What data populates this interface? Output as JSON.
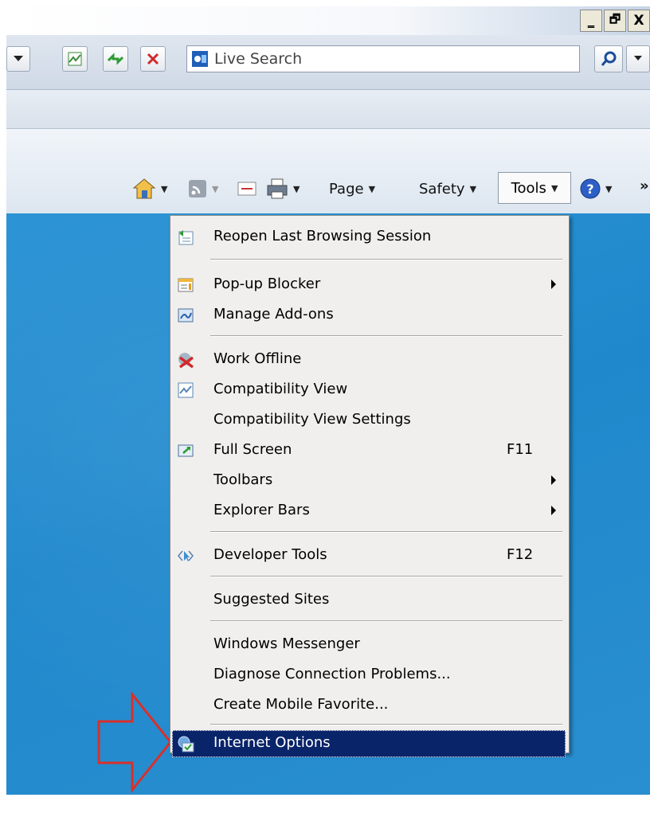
{
  "window": {
    "min_label": "_",
    "restore_label": "🗗",
    "close_label": "X"
  },
  "toolbar": {
    "search_placeholder": "Live Search",
    "icons": [
      "dropdown-icon",
      "compatibility-view-icon",
      "refresh-icon",
      "stop-icon",
      "live-search-logo",
      "search-icon",
      "search-options-icon"
    ]
  },
  "command_bar": {
    "page": "Page",
    "safety": "Safety",
    "tools": "Tools",
    "more": "»"
  },
  "menu": {
    "items": [
      {
        "label": "Reopen Last Browsing Session",
        "icon": "reopen-session-icon"
      },
      {
        "label": "Pop-up Blocker",
        "icon": "popup-blocker-icon",
        "submenu": true
      },
      {
        "label": "Manage Add-ons",
        "icon": "manage-addons-icon"
      },
      {
        "label": "Work Offline",
        "icon": "work-offline-icon"
      },
      {
        "label": "Compatibility View",
        "icon": "compatibility-view-icon"
      },
      {
        "label": "Compatibility View Settings"
      },
      {
        "label": "Full Screen",
        "icon": "full-screen-icon",
        "shortcut": "F11"
      },
      {
        "label": "Toolbars",
        "submenu": true
      },
      {
        "label": "Explorer Bars",
        "submenu": true
      },
      {
        "label": "Developer Tools",
        "icon": "developer-tools-icon",
        "shortcut": "F12"
      },
      {
        "label": "Suggested Sites"
      },
      {
        "label": "Windows Messenger"
      },
      {
        "label": "Diagnose Connection Problems..."
      },
      {
        "label": "Create Mobile Favorite..."
      },
      {
        "label": "Internet Options",
        "icon": "internet-options-icon",
        "highlighted": true
      }
    ]
  },
  "colors": {
    "menu_bg": "#f0efed",
    "highlight": "#0a246a",
    "page_blue": "#2290d2",
    "annotation_arrow": "#d9302c"
  }
}
